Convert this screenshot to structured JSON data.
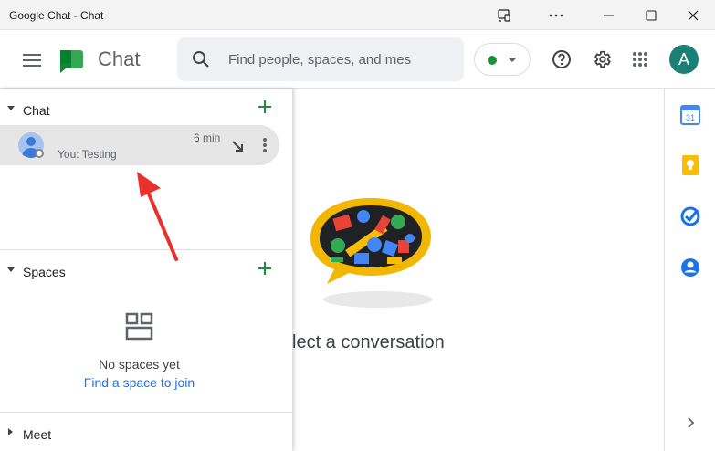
{
  "window": {
    "title": "Google Chat - Chat",
    "buttons": [
      "cast-icon",
      "more-icon",
      "minimize-icon",
      "maximize-icon",
      "close-icon"
    ]
  },
  "header": {
    "brand": "Chat",
    "search_placeholder": "Find people, spaces, and mes",
    "status_color": "#1e8e3e",
    "avatar_letter": "A"
  },
  "sidebar": {
    "chat_section": {
      "label": "Chat",
      "items": [
        {
          "preview": "You: Testing",
          "time": "6 min"
        }
      ]
    },
    "spaces_section": {
      "label": "Spaces",
      "empty_text": "No spaces yet",
      "link": "Find a space to join"
    },
    "meet_section": {
      "label": "Meet"
    }
  },
  "main": {
    "empty_state_text": "lect a conversation"
  },
  "colors": {
    "accent_green": "#1e8e3e",
    "link_blue": "#1a73e8",
    "annotation_red": "#e8312a"
  }
}
